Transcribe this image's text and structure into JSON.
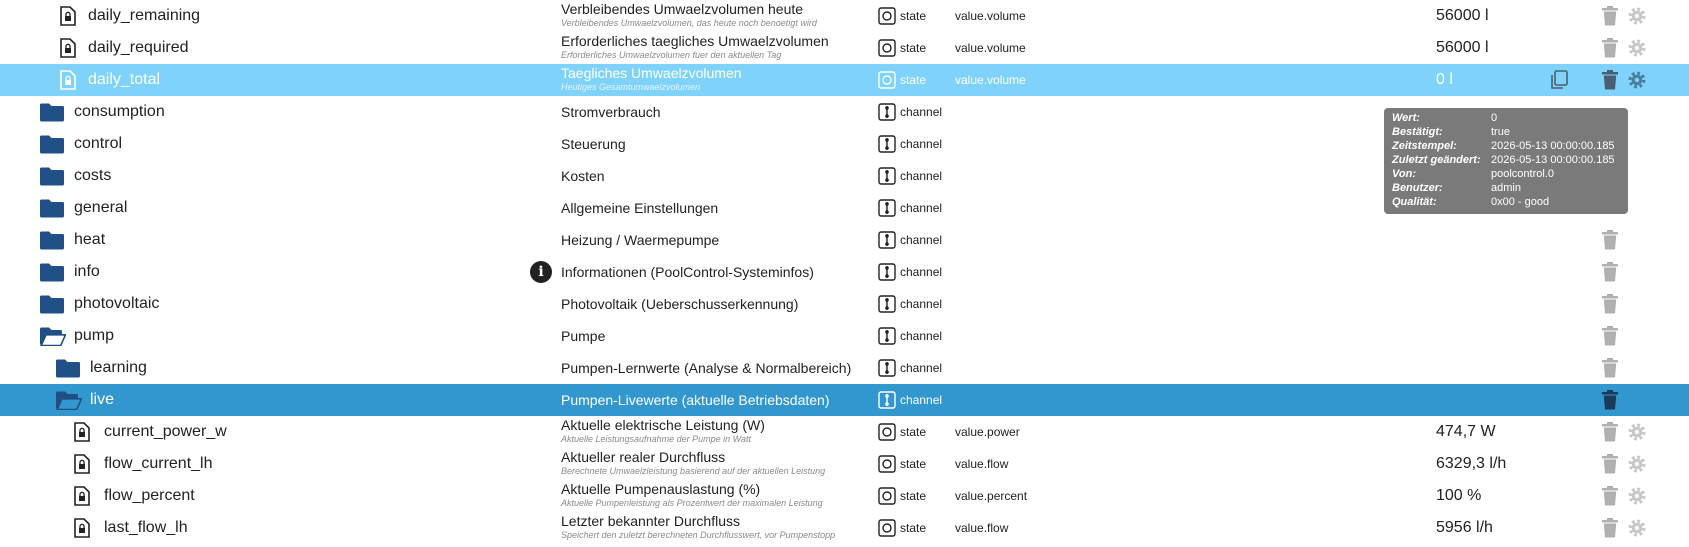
{
  "colors": {
    "folder": "#1f4f85",
    "selected_light": "#7fd3fb",
    "selected_dark": "#3296cf",
    "action_gray": "#b0b0b0",
    "tooltip_bg": "#7a7a7a"
  },
  "rows": [
    {
      "name": "daily_remaining",
      "desc": "Verbleibendes Umwaelzvolumen heute",
      "sub": "Verbleibendes Umwaelzvolumen, das heute noch benoetigt wird",
      "type": "state",
      "role": "value.volume",
      "value": "56000 l"
    },
    {
      "name": "daily_required",
      "desc": "Erforderliches taegliches Umwaelzvolumen",
      "sub": "Erforderliches Umwaelzvolumen fuer den aktuellen Tag",
      "type": "state",
      "role": "value.volume",
      "value": "56000 l"
    },
    {
      "name": "daily_total",
      "desc": "Taegliches Umwaelzvolumen",
      "sub": "Heutiges Gesamtumwaelzvolumen",
      "type": "state",
      "role": "value.volume",
      "value": "0 l"
    },
    {
      "name": "consumption",
      "desc": "Stromverbrauch",
      "type": "channel"
    },
    {
      "name": "control",
      "desc": "Steuerung",
      "type": "channel"
    },
    {
      "name": "costs",
      "desc": "Kosten",
      "type": "channel"
    },
    {
      "name": "general",
      "desc": "Allgemeine Einstellungen",
      "type": "channel"
    },
    {
      "name": "heat",
      "desc": "Heizung / Waermepumpe",
      "type": "channel"
    },
    {
      "name": "info",
      "desc": "Informationen (PoolControl-Systeminfos)",
      "type": "channel",
      "info_icon": "i"
    },
    {
      "name": "photovoltaic",
      "desc": "Photovoltaik (Ueberschusserkennung)",
      "type": "channel"
    },
    {
      "name": "pump",
      "desc": "Pumpe",
      "type": "channel"
    },
    {
      "name": "learning",
      "desc": "Pumpen-Lernwerte (Analyse & Normalbereich)",
      "type": "channel"
    },
    {
      "name": "live",
      "desc": "Pumpen-Livewerte (aktuelle Betriebsdaten)",
      "type": "channel"
    },
    {
      "name": "current_power_w",
      "desc": "Aktuelle elektrische Leistung (W)",
      "sub": "Aktuelle Leistungsaufnahme der Pumpe in Watt",
      "type": "state",
      "role": "value.power",
      "value": "474,7 W"
    },
    {
      "name": "flow_current_lh",
      "desc": "Aktueller realer Durchfluss",
      "sub": "Berechnete Umwaelzleistung basierend auf der aktuellen Leistung",
      "type": "state",
      "role": "value.flow",
      "value": "6329,3 l/h"
    },
    {
      "name": "flow_percent",
      "desc": "Aktuelle Pumpenauslastung (%)",
      "sub": "Aktuelle Pumpenleistung als Prozentwert der maximalen Leistung",
      "type": "state",
      "role": "value.percent",
      "value": "100 %"
    },
    {
      "name": "last_flow_lh",
      "desc": "Letzter bekannter Durchfluss",
      "sub": "Speichert den zuletzt berechneten Durchflusswert, vor Pumpenstopp",
      "type": "state",
      "role": "value.flow",
      "value": "5956 l/h"
    }
  ],
  "tooltip": [
    {
      "label": "Wert:",
      "value": "0"
    },
    {
      "label": "Bestätigt:",
      "value": "true"
    },
    {
      "label": "Zeitstempel:",
      "value": "2026-05-13 00:00:00.185"
    },
    {
      "label": "Zuletzt geändert:",
      "value": "2026-05-13 00:00:00.185"
    },
    {
      "label": "Von:",
      "value": "poolcontrol.0"
    },
    {
      "label": "Benutzer:",
      "value": "admin"
    },
    {
      "label": "Qualität:",
      "value": "0x00 - good"
    }
  ]
}
